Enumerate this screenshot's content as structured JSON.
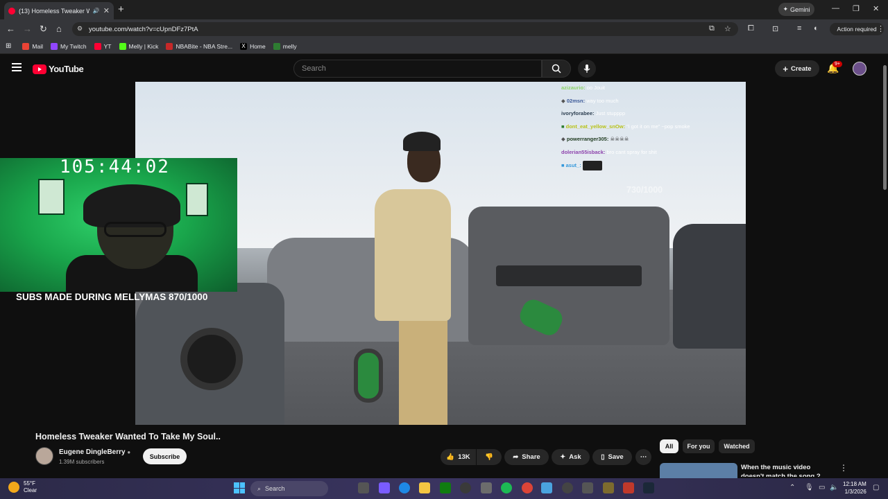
{
  "browser": {
    "tab_title": "(13) Homeless Tweaker Wa",
    "new_tab": "+",
    "gemini_label": "Gemini",
    "url": "youtube.com/watch?v=cUpnDFz7PtA",
    "action_required": "Action required",
    "bookmarks": [
      {
        "label": "Mail",
        "color": "#ea4335"
      },
      {
        "label": "My Twitch",
        "color": "#9146ff"
      },
      {
        "label": "YT",
        "color": "#ff0033"
      },
      {
        "label": "Melly | Kick",
        "color": "#53fc18"
      },
      {
        "label": "NBABite - NBA Stre...",
        "color": "#c62828"
      },
      {
        "label": "Home",
        "color": "#e8eaed"
      },
      {
        "label": "melly",
        "color": "#2e7d32"
      }
    ]
  },
  "youtube": {
    "logo_text": "YouTube",
    "search_placeholder": "Search",
    "create_label": "Create",
    "notifications_badge": "9+"
  },
  "overlay": {
    "chat": [
      {
        "user": "azizaurio:",
        "msg": "oo Jouit",
        "color": "#8fd46a"
      },
      {
        "user": "02msn:",
        "msg": "way too much",
        "color": "#3d5a99"
      },
      {
        "user": "ivoryforabee:",
        "msg": "Just stupppp",
        "color": "#2c3e50"
      },
      {
        "user": "dont_eat_yellow_snOw:",
        "msg": "\"i got it on me\" ~pop smoke",
        "color": "#b8c218"
      },
      {
        "user": "powerranger305:",
        "msg": "",
        "color": "#1e3a1e"
      },
      {
        "user": "dolerian55isback:",
        "msg": "bro cant spray for shit",
        "color": "#8e44ad"
      },
      {
        "user": "asut_:",
        "msg": "",
        "color": "#3498db"
      }
    ],
    "follower_goal": "730/1000",
    "timer": "105:44:02",
    "subs_goal": "SUBS MADE DURING MELLYMAS 870/1000"
  },
  "video": {
    "title": "Homeless Tweaker Wanted To Take My Soul..",
    "channel": "Eugene DingleBerry",
    "subscribers": "1.39M subscribers",
    "subscribe_label": "Subscribe",
    "likes": "13K",
    "share_label": "Share",
    "ask_label": "Ask",
    "save_label": "Save"
  },
  "sidebar": {
    "chips": [
      "All",
      "For you",
      "Watched"
    ],
    "rec_title": "When the music video doesn't match the song ?"
  },
  "taskbar": {
    "temperature": "55°F",
    "condition": "Clear",
    "search_label": "Search",
    "time": "12:18 AM",
    "date": "1/3/2026"
  }
}
